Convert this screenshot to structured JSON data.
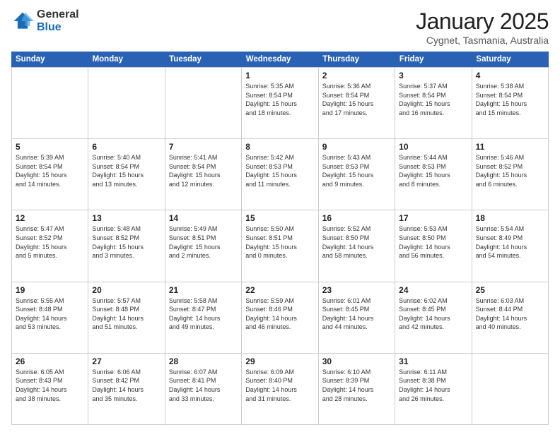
{
  "logo": {
    "general": "General",
    "blue": "Blue"
  },
  "title": {
    "month": "January 2025",
    "location": "Cygnet, Tasmania, Australia"
  },
  "weekdays": [
    "Sunday",
    "Monday",
    "Tuesday",
    "Wednesday",
    "Thursday",
    "Friday",
    "Saturday"
  ],
  "weeks": [
    [
      {
        "day": "",
        "info": ""
      },
      {
        "day": "",
        "info": ""
      },
      {
        "day": "",
        "info": ""
      },
      {
        "day": "1",
        "info": "Sunrise: 5:35 AM\nSunset: 8:54 PM\nDaylight: 15 hours\nand 18 minutes."
      },
      {
        "day": "2",
        "info": "Sunrise: 5:36 AM\nSunset: 8:54 PM\nDaylight: 15 hours\nand 17 minutes."
      },
      {
        "day": "3",
        "info": "Sunrise: 5:37 AM\nSunset: 8:54 PM\nDaylight: 15 hours\nand 16 minutes."
      },
      {
        "day": "4",
        "info": "Sunrise: 5:38 AM\nSunset: 8:54 PM\nDaylight: 15 hours\nand 15 minutes."
      }
    ],
    [
      {
        "day": "5",
        "info": "Sunrise: 5:39 AM\nSunset: 8:54 PM\nDaylight: 15 hours\nand 14 minutes."
      },
      {
        "day": "6",
        "info": "Sunrise: 5:40 AM\nSunset: 8:54 PM\nDaylight: 15 hours\nand 13 minutes."
      },
      {
        "day": "7",
        "info": "Sunrise: 5:41 AM\nSunset: 8:54 PM\nDaylight: 15 hours\nand 12 minutes."
      },
      {
        "day": "8",
        "info": "Sunrise: 5:42 AM\nSunset: 8:53 PM\nDaylight: 15 hours\nand 11 minutes."
      },
      {
        "day": "9",
        "info": "Sunrise: 5:43 AM\nSunset: 8:53 PM\nDaylight: 15 hours\nand 9 minutes."
      },
      {
        "day": "10",
        "info": "Sunrise: 5:44 AM\nSunset: 8:53 PM\nDaylight: 15 hours\nand 8 minutes."
      },
      {
        "day": "11",
        "info": "Sunrise: 5:46 AM\nSunset: 8:52 PM\nDaylight: 15 hours\nand 6 minutes."
      }
    ],
    [
      {
        "day": "12",
        "info": "Sunrise: 5:47 AM\nSunset: 8:52 PM\nDaylight: 15 hours\nand 5 minutes."
      },
      {
        "day": "13",
        "info": "Sunrise: 5:48 AM\nSunset: 8:52 PM\nDaylight: 15 hours\nand 3 minutes."
      },
      {
        "day": "14",
        "info": "Sunrise: 5:49 AM\nSunset: 8:51 PM\nDaylight: 15 hours\nand 2 minutes."
      },
      {
        "day": "15",
        "info": "Sunrise: 5:50 AM\nSunset: 8:51 PM\nDaylight: 15 hours\nand 0 minutes."
      },
      {
        "day": "16",
        "info": "Sunrise: 5:52 AM\nSunset: 8:50 PM\nDaylight: 14 hours\nand 58 minutes."
      },
      {
        "day": "17",
        "info": "Sunrise: 5:53 AM\nSunset: 8:50 PM\nDaylight: 14 hours\nand 56 minutes."
      },
      {
        "day": "18",
        "info": "Sunrise: 5:54 AM\nSunset: 8:49 PM\nDaylight: 14 hours\nand 54 minutes."
      }
    ],
    [
      {
        "day": "19",
        "info": "Sunrise: 5:55 AM\nSunset: 8:48 PM\nDaylight: 14 hours\nand 53 minutes."
      },
      {
        "day": "20",
        "info": "Sunrise: 5:57 AM\nSunset: 8:48 PM\nDaylight: 14 hours\nand 51 minutes."
      },
      {
        "day": "21",
        "info": "Sunrise: 5:58 AM\nSunset: 8:47 PM\nDaylight: 14 hours\nand 49 minutes."
      },
      {
        "day": "22",
        "info": "Sunrise: 5:59 AM\nSunset: 8:46 PM\nDaylight: 14 hours\nand 46 minutes."
      },
      {
        "day": "23",
        "info": "Sunrise: 6:01 AM\nSunset: 8:45 PM\nDaylight: 14 hours\nand 44 minutes."
      },
      {
        "day": "24",
        "info": "Sunrise: 6:02 AM\nSunset: 8:45 PM\nDaylight: 14 hours\nand 42 minutes."
      },
      {
        "day": "25",
        "info": "Sunrise: 6:03 AM\nSunset: 8:44 PM\nDaylight: 14 hours\nand 40 minutes."
      }
    ],
    [
      {
        "day": "26",
        "info": "Sunrise: 6:05 AM\nSunset: 8:43 PM\nDaylight: 14 hours\nand 38 minutes."
      },
      {
        "day": "27",
        "info": "Sunrise: 6:06 AM\nSunset: 8:42 PM\nDaylight: 14 hours\nand 35 minutes."
      },
      {
        "day": "28",
        "info": "Sunrise: 6:07 AM\nSunset: 8:41 PM\nDaylight: 14 hours\nand 33 minutes."
      },
      {
        "day": "29",
        "info": "Sunrise: 6:09 AM\nSunset: 8:40 PM\nDaylight: 14 hours\nand 31 minutes."
      },
      {
        "day": "30",
        "info": "Sunrise: 6:10 AM\nSunset: 8:39 PM\nDaylight: 14 hours\nand 28 minutes."
      },
      {
        "day": "31",
        "info": "Sunrise: 6:11 AM\nSunset: 8:38 PM\nDaylight: 14 hours\nand 26 minutes."
      },
      {
        "day": "",
        "info": ""
      }
    ]
  ]
}
